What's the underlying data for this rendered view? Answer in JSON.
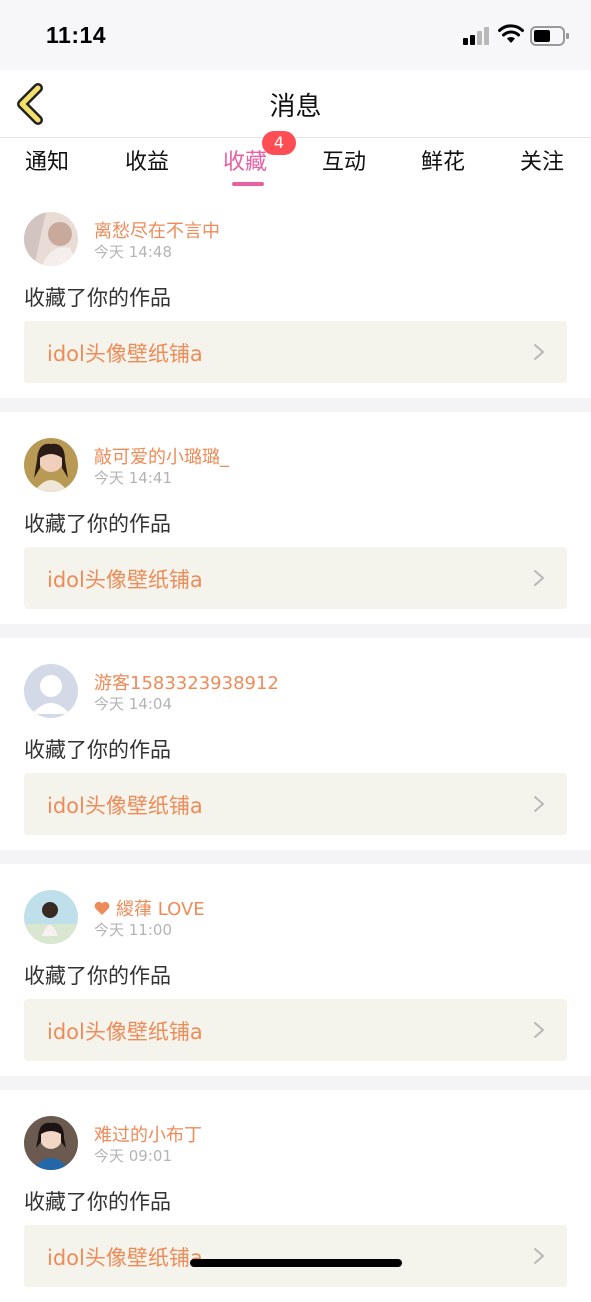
{
  "status_bar": {
    "time": "11:14"
  },
  "nav": {
    "title": "消息"
  },
  "tabs": [
    {
      "label": "通知",
      "active": false
    },
    {
      "label": "收益",
      "active": false
    },
    {
      "label": "收藏",
      "active": true,
      "badge": "4"
    },
    {
      "label": "互动",
      "active": false
    },
    {
      "label": "鲜花",
      "active": false
    },
    {
      "label": "关注",
      "active": false
    }
  ],
  "items": [
    {
      "username": "离愁尽在不言中",
      "time": "今天 14:48",
      "action": "收藏了你的作品",
      "work": "idol头像壁纸铺a",
      "has_heart": false
    },
    {
      "username": "敲可爱的小璐璐_",
      "time": "今天 14:41",
      "action": "收藏了你的作品",
      "work": "idol头像壁纸铺a",
      "has_heart": false
    },
    {
      "username": "游客1583323938912",
      "time": "今天 14:04",
      "action": "收藏了你的作品",
      "work": "idol头像壁纸铺a",
      "has_heart": false
    },
    {
      "username": "緵葎 LOVE",
      "time": "今天 11:00",
      "action": "收藏了你的作品",
      "work": "idol头像壁纸铺a",
      "has_heart": true
    },
    {
      "username": "难过的小布丁",
      "time": "今天 09:01",
      "action": "收藏了你的作品",
      "work": "idol头像壁纸铺a",
      "has_heart": false
    }
  ],
  "colors": {
    "accent_pink": "#e85fa3",
    "username_orange": "#ef8b58",
    "badge_red": "#ff4d55",
    "card_bg": "#f4f4ec"
  }
}
